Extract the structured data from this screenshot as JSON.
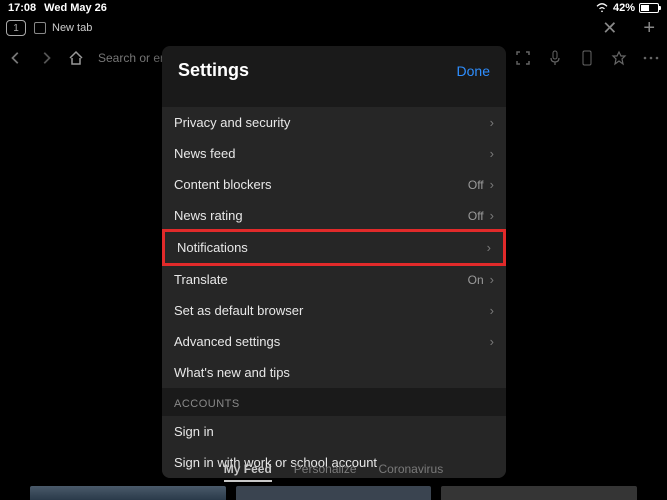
{
  "status": {
    "time": "17:08",
    "date": "Wed May 26",
    "battery_percent": "42%"
  },
  "tabs": {
    "count": "1",
    "current_label": "New tab"
  },
  "toolbar": {
    "url_placeholder": "Search or ent"
  },
  "settings": {
    "title": "Settings",
    "done_label": "Done",
    "rows": [
      {
        "label": "Privacy and security",
        "value": ""
      },
      {
        "label": "News feed",
        "value": ""
      },
      {
        "label": "Content blockers",
        "value": "Off"
      },
      {
        "label": "News rating",
        "value": "Off"
      },
      {
        "label": "Notifications",
        "value": ""
      },
      {
        "label": "Translate",
        "value": "On"
      },
      {
        "label": "Set as default browser",
        "value": ""
      },
      {
        "label": "Advanced settings",
        "value": ""
      },
      {
        "label": "What's new and tips",
        "value": ""
      }
    ],
    "accounts_header": "ACCOUNTS",
    "account_rows": [
      {
        "label": "Sign in"
      },
      {
        "label": "Sign in with work or school account"
      }
    ]
  },
  "feed": {
    "tabs": [
      "My Feed",
      "Personalize",
      "Coronavirus"
    ],
    "active_index": 0
  }
}
